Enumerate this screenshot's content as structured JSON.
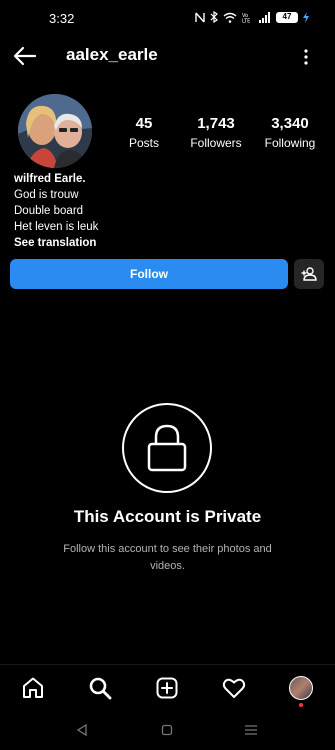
{
  "status_bar": {
    "time": "3:32",
    "battery": "47",
    "icons": [
      "nfc-icon",
      "bluetooth-icon",
      "wifi-icon",
      "volte-icon",
      "signal-icon",
      "battery-icon",
      "charging-icon"
    ]
  },
  "header": {
    "username": "aalex_earle",
    "back_icon": "arrow-left-icon",
    "menu_icon": "more-vertical-icon"
  },
  "profile": {
    "stats": [
      {
        "value": "45",
        "label": "Posts"
      },
      {
        "value": "1,743",
        "label": "Followers"
      },
      {
        "value": "3,340",
        "label": "Following"
      }
    ],
    "bio": {
      "name": "wilfred Earle.",
      "lines": [
        "God is trouw",
        "Double board",
        "Het leven is leuk"
      ],
      "see_translation": "See translation"
    }
  },
  "actions": {
    "follow_label": "Follow",
    "suggest_icon": "add-person-icon",
    "accent_color": "#2a8cf0"
  },
  "private_notice": {
    "title": "This Account is Private",
    "description": "Follow this account to see their photos and videos.",
    "icon": "lock-icon"
  },
  "bottom_nav": {
    "items": [
      "home-icon",
      "search-icon",
      "create-icon",
      "heart-icon",
      "profile-avatar"
    ]
  },
  "system_nav": {
    "items": [
      "back-triangle-icon",
      "home-square-icon",
      "recents-menu-icon"
    ]
  }
}
